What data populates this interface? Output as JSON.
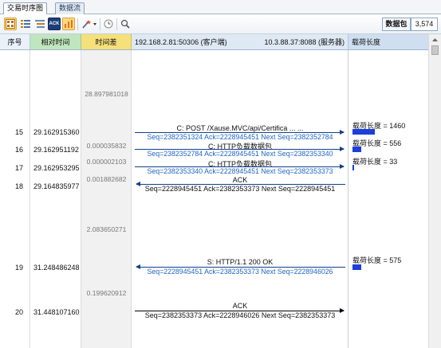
{
  "tabs": [
    {
      "label": "交易时序图",
      "active": true
    },
    {
      "label": "数据流",
      "active": false
    }
  ],
  "toolbar": {
    "icons": [
      "grid-view-icon",
      "list-view-icon",
      "list-detail-icon",
      "ack-icon",
      "chart-icon",
      "filter-wand-icon",
      "clock-icon",
      "search-icon"
    ],
    "ack_label": "ACK",
    "packet_label": "数据包",
    "packet_count": "3,574"
  },
  "columns": {
    "seq": "序号",
    "relative_time": "相对时间",
    "time_diff": "时间差",
    "client": "192.168.2.81:50306 (客户端)",
    "server": "10.3.88.37:8088 (服务器)",
    "payload_length": "载荷长度"
  },
  "time_diffs": [
    {
      "value": "28.897981018"
    },
    {
      "value": "0.000035832"
    },
    {
      "value": "0.000002103"
    },
    {
      "value": "0.001882682"
    },
    {
      "value": "2.083650271"
    },
    {
      "value": "0.199620912"
    }
  ],
  "packets": [
    {
      "seq": "15",
      "rel": "29.162915360",
      "direction": "c2s",
      "label": "C: POST /Xause.MVC/api/Certifica ... ...",
      "detail": "Seq=2382351324  Ack=2228945451   Next Seq=2382352784",
      "length_label": "载荷长度 = 1460",
      "length": 1460
    },
    {
      "seq": "16",
      "rel": "29.162951192",
      "direction": "c2s",
      "label": "C: HTTP负载数据包",
      "detail": "Seq=2382352784  Ack=2228945451   Next Seq=2382353340",
      "length_label": "载荷长度 = 556",
      "length": 556
    },
    {
      "seq": "17",
      "rel": "29.162953295",
      "direction": "c2s",
      "label": "C: HTTP负载数据包",
      "detail": "Seq=2382353340  Ack=2228945451   Next Seq=2382353373",
      "length_label": "载荷长度 = 33",
      "length": 33
    },
    {
      "seq": "18",
      "rel": "29.164835977",
      "direction": "s2c",
      "label": "ACK",
      "detail": "Seq=2228945451   Ack=2382353373   Next Seq=2228945451",
      "length_label": "",
      "length": 0
    },
    {
      "seq": "19",
      "rel": "31.248486248",
      "direction": "s2c",
      "label": "S: HTTP/1.1 200 OK",
      "detail": "Seq=2228945451   Ack=2382353373   Next Seq=2228946026",
      "length_label": "载荷长度 = 575",
      "length": 575
    },
    {
      "seq": "20",
      "rel": "31.448107160",
      "direction": "c2s",
      "label": "ACK",
      "detail": "Seq=2382353373   Ack=2228946026   Next Seq=2382353373",
      "length_label": "",
      "length": 0
    }
  ],
  "colors": {
    "arrow_blue": "#123f8c",
    "detail_blue": "#1f66c6",
    "length_bar": "#1b3fd8",
    "header_green": "#bfe6bd",
    "header_yellow": "#f6e07a"
  }
}
